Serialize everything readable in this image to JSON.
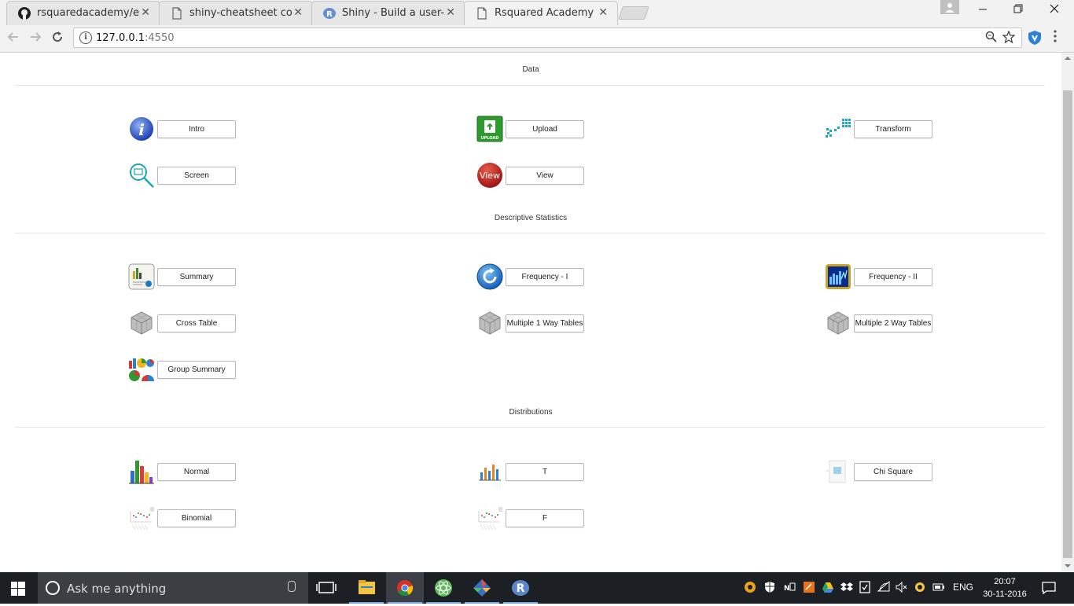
{
  "browser": {
    "tabs": [
      {
        "title": "rsquaredacademy/explor",
        "icon": "github-icon",
        "active": false
      },
      {
        "title": "shiny-cheatsheet copy",
        "icon": "document-icon",
        "active": false
      },
      {
        "title": "Shiny - Build a user-inter",
        "icon": "r-logo-icon",
        "active": false
      },
      {
        "title": "Rsquared Academy",
        "icon": "document-icon",
        "active": true
      }
    ],
    "url": {
      "host": "127.0.0.1",
      "port": ":4550"
    },
    "close_glyph": "✕"
  },
  "page": {
    "sections": [
      {
        "title": "Data",
        "items": [
          {
            "label": "Intro",
            "icon": "info-icon"
          },
          {
            "label": "Upload",
            "icon": "upload-icon"
          },
          {
            "label": "Transform",
            "icon": "transform-icon"
          },
          {
            "label": "Screen",
            "icon": "magnifier-icon"
          },
          {
            "label": "View",
            "icon": "view-icon",
            "icon_text": "View"
          }
        ]
      },
      {
        "title": "Descriptive Statistics",
        "items": [
          {
            "label": "Summary",
            "icon": "report-icon"
          },
          {
            "label": "Frequency - I",
            "icon": "refresh-icon"
          },
          {
            "label": "Frequency - II",
            "icon": "bar-chart-icon"
          },
          {
            "label": "Cross Table",
            "icon": "cube-icon"
          },
          {
            "label": "Multiple 1 Way Tables",
            "icon": "cube-icon"
          },
          {
            "label": "Multiple 2 Way Tables",
            "icon": "cube-icon"
          },
          {
            "label": "Group Summary",
            "icon": "pie-charts-icon"
          }
        ]
      },
      {
        "title": "Distributions",
        "items": [
          {
            "label": "Normal",
            "icon": "colored-bars-icon"
          },
          {
            "label": "T",
            "icon": "small-bars-icon"
          },
          {
            "label": "Chi Square",
            "icon": "chi-square-icon"
          },
          {
            "label": "Binomial",
            "icon": "dot-plot-icon"
          },
          {
            "label": "F",
            "icon": "dot-plot-icon"
          }
        ]
      }
    ]
  },
  "taskbar": {
    "search_placeholder": "Ask me anything",
    "language": "ENG",
    "time": "20:07",
    "date": "30-11-2016"
  },
  "colors": {
    "chrome_bg": "#f2f2f2",
    "taskbar_bg": "#1c1f24",
    "divider": "#e5e5e5"
  }
}
